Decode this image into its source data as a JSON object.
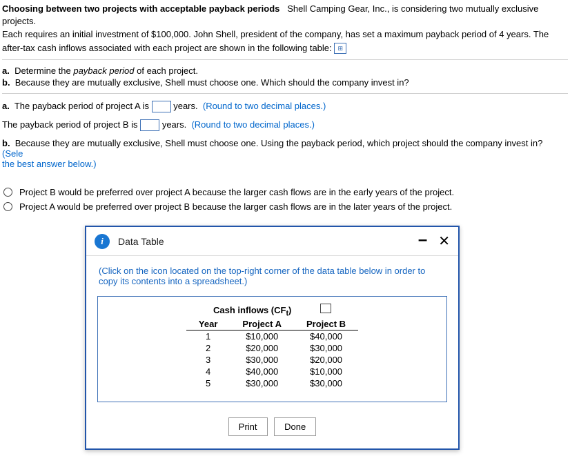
{
  "header": {
    "title": "Choosing between two projects with acceptable payback periods",
    "intro1": "Shell Camping Gear, Inc., is considering two mutually exclusive projects.",
    "intro2": "Each requires an initial investment of $100,000.  John Shell, president of the company, has set a maximum payback period of 4 years.  The",
    "intro3": "after-tax cash inflows associated with each project are shown in the following table:"
  },
  "questions": {
    "a": {
      "label": "a.",
      "text1": "Determine the ",
      "italic": "payback period",
      "text2": " of each project."
    },
    "b": {
      "label": "b.",
      "text": "Because they are mutually exclusive, Shell must choose one. Which should the company invest in?"
    }
  },
  "answers": {
    "a_prefix": "a.",
    "a_text1": "The payback period of project A is",
    "a_text2": "years.",
    "a_hint": "(Round to two decimal places.)",
    "b_text1": "The payback period of project B is",
    "b_text2": "years.",
    "b_hint": "(Round to two decimal places.)",
    "part_b_prefix": "b.",
    "part_b_text": "Because they are mutually exclusive, Shell must choose one.  Using the payback period, which project should the company invest in?",
    "part_b_hint1": "(Sele",
    "part_b_hint2": "the best answer below.)"
  },
  "options": {
    "opt1": "Project B would be preferred over project A because the larger cash flows are in the early years of the project.",
    "opt2": "Project A would be preferred over project B because the larger cash flows are in the later years of the project."
  },
  "modal": {
    "title": "Data Table",
    "instructions": "(Click on the icon located on the top-right corner of the data table below in order to copy its contents into a spreadsheet.)",
    "cf_header": "Cash inflows (CF",
    "cf_sub": "t",
    "cf_close": ")",
    "col_year": "Year",
    "col_a": "Project A",
    "col_b": "Project B",
    "footer": {
      "print": "Print",
      "done": "Done"
    }
  },
  "chart_data": {
    "type": "table",
    "title": "Cash inflows (CFt)",
    "columns": [
      "Year",
      "Project A",
      "Project B"
    ],
    "rows": [
      {
        "year": "1",
        "a": "$10,000",
        "b": "$40,000"
      },
      {
        "year": "2",
        "a": "$20,000",
        "b": "$30,000"
      },
      {
        "year": "3",
        "a": "$30,000",
        "b": "$20,000"
      },
      {
        "year": "4",
        "a": "$40,000",
        "b": "$10,000"
      },
      {
        "year": "5",
        "a": "$30,000",
        "b": "$30,000"
      }
    ]
  }
}
